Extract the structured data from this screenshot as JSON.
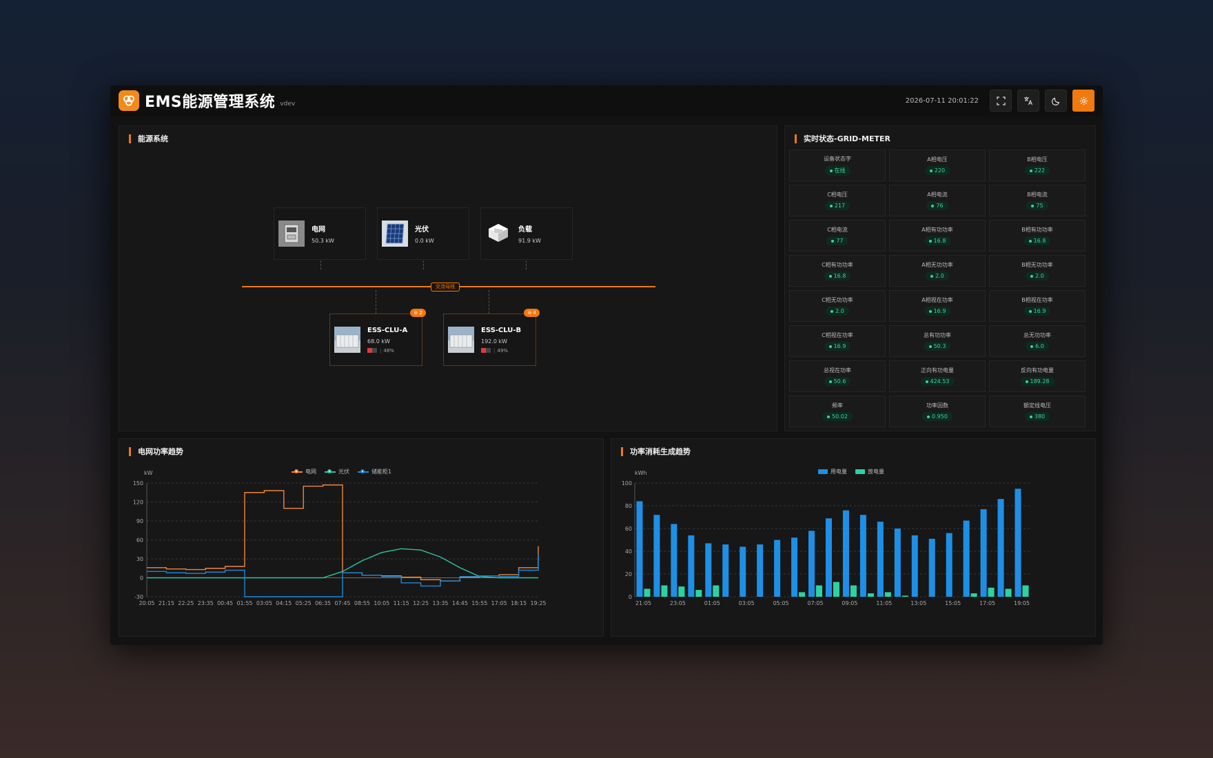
{
  "header": {
    "title": "EMS能源管理系统",
    "version": "vdev",
    "datetime": "2026-07-11 20:01:22"
  },
  "energy_system": {
    "title": "能源系统",
    "nodes": [
      {
        "name": "电网",
        "value": "50.3",
        "unit": "kW",
        "icon": "grid-meter-icon"
      },
      {
        "name": "光伏",
        "value": "0.0",
        "unit": "kW",
        "icon": "solar-panel-icon"
      },
      {
        "name": "负载",
        "value": "91.9",
        "unit": "kW",
        "icon": "load-icon"
      }
    ],
    "bus_label": "交流母线",
    "ess": [
      {
        "name": "ESS-CLU-A",
        "value": "68.0",
        "unit": "kW",
        "soc": "48%",
        "soc_value": 0.48,
        "badge": "2"
      },
      {
        "name": "ESS-CLU-B",
        "value": "192.0",
        "unit": "kW",
        "soc": "49%",
        "soc_value": 0.49,
        "badge": "4"
      }
    ]
  },
  "meter": {
    "title": "实时状态-GRID-METER",
    "cells": [
      {
        "label": "设备状态字",
        "value": "在线"
      },
      {
        "label": "A相电压",
        "value": "220"
      },
      {
        "label": "B相电压",
        "value": "222"
      },
      {
        "label": "C相电压",
        "value": "217"
      },
      {
        "label": "A相电流",
        "value": "76"
      },
      {
        "label": "B相电流",
        "value": "75"
      },
      {
        "label": "C相电流",
        "value": "77"
      },
      {
        "label": "A相有功功率",
        "value": "16.8"
      },
      {
        "label": "B相有功功率",
        "value": "16.8"
      },
      {
        "label": "C相有功功率",
        "value": "16.8"
      },
      {
        "label": "A相无功功率",
        "value": "2.0"
      },
      {
        "label": "B相无功功率",
        "value": "2.0"
      },
      {
        "label": "C相无功功率",
        "value": "2.0"
      },
      {
        "label": "A相视在功率",
        "value": "16.9"
      },
      {
        "label": "B相视在功率",
        "value": "16.9"
      },
      {
        "label": "C相视在功率",
        "value": "16.9"
      },
      {
        "label": "总有功功率",
        "value": "50.3"
      },
      {
        "label": "总无功功率",
        "value": "6.0"
      },
      {
        "label": "总视在功率",
        "value": "50.6"
      },
      {
        "label": "正向有功电量",
        "value": "424.53"
      },
      {
        "label": "反向有功电量",
        "value": "189.28"
      },
      {
        "label": "频率",
        "value": "50.02"
      },
      {
        "label": "功率因数",
        "value": "0.950"
      },
      {
        "label": "额定线电压",
        "value": "380"
      }
    ]
  },
  "colors": {
    "accent": "#f07a10",
    "grid_series": "#f0873a",
    "pv_series": "#2ec4a0",
    "ess_series": "#1e88d8",
    "consume_bar": "#1e8fe6",
    "generate_bar": "#2bd3a2"
  },
  "chart_data": [
    {
      "type": "line",
      "title": "电网功率趋势",
      "ylabel": "kW",
      "ylim": [
        -30,
        150
      ],
      "yticks": [
        -30,
        0,
        30,
        60,
        90,
        120,
        150
      ],
      "x": [
        "20:05",
        "21:15",
        "22:25",
        "23:35",
        "00:45",
        "01:55",
        "03:05",
        "04:15",
        "05:25",
        "06:35",
        "07:45",
        "08:55",
        "10:05",
        "11:15",
        "12:25",
        "13:35",
        "14:45",
        "15:55",
        "17:05",
        "18:15",
        "19:25"
      ],
      "series": [
        {
          "name": "电网",
          "values": [
            16,
            14,
            13,
            15,
            18,
            135,
            138,
            110,
            145,
            147,
            8,
            4,
            3,
            1,
            -3,
            -5,
            1,
            3,
            5,
            16,
            50
          ]
        },
        {
          "name": "光伏",
          "values": [
            0,
            0,
            0,
            0,
            0,
            0,
            0,
            0,
            0,
            0,
            10,
            27,
            40,
            46,
            44,
            33,
            16,
            2,
            0,
            0,
            0
          ]
        },
        {
          "name": "储能柜1",
          "values": [
            10,
            8,
            7,
            9,
            12,
            -30,
            -30,
            -30,
            -30,
            -30,
            8,
            4,
            2,
            -8,
            -13,
            -5,
            2,
            3,
            2,
            12,
            38
          ]
        }
      ],
      "legend": "top-center",
      "grid": true
    },
    {
      "type": "bar",
      "title": "功率消耗生成趋势",
      "ylabel": "kWh",
      "ylim": [
        0,
        100
      ],
      "yticks": [
        0,
        20,
        40,
        60,
        80,
        100
      ],
      "categories": [
        "21:05",
        "22:05",
        "23:05",
        "00:05",
        "01:05",
        "02:05",
        "03:05",
        "04:05",
        "05:05",
        "06:05",
        "07:05",
        "08:05",
        "09:05",
        "10:05",
        "11:05",
        "12:05",
        "13:05",
        "14:05",
        "15:05",
        "16:05",
        "17:05",
        "18:05",
        "19:05"
      ],
      "xtick_labels": [
        "21:05",
        "23:05",
        "01:05",
        "03:05",
        "05:05",
        "07:05",
        "09:05",
        "11:05",
        "13:05",
        "15:05",
        "17:05",
        "19:05"
      ],
      "series": [
        {
          "name": "用电量",
          "values": [
            84,
            72,
            64,
            54,
            47,
            46,
            44,
            46,
            50,
            52,
            58,
            69,
            76,
            72,
            66,
            60,
            54,
            51,
            56,
            67,
            77,
            86,
            95
          ]
        },
        {
          "name": "放电量",
          "values": [
            7,
            10,
            9,
            6,
            10,
            0,
            0,
            0,
            0,
            4,
            10,
            13,
            10,
            3,
            4,
            1,
            0,
            0,
            0,
            3,
            8,
            7,
            10
          ]
        }
      ],
      "legend": "top-center",
      "grid": true
    }
  ]
}
